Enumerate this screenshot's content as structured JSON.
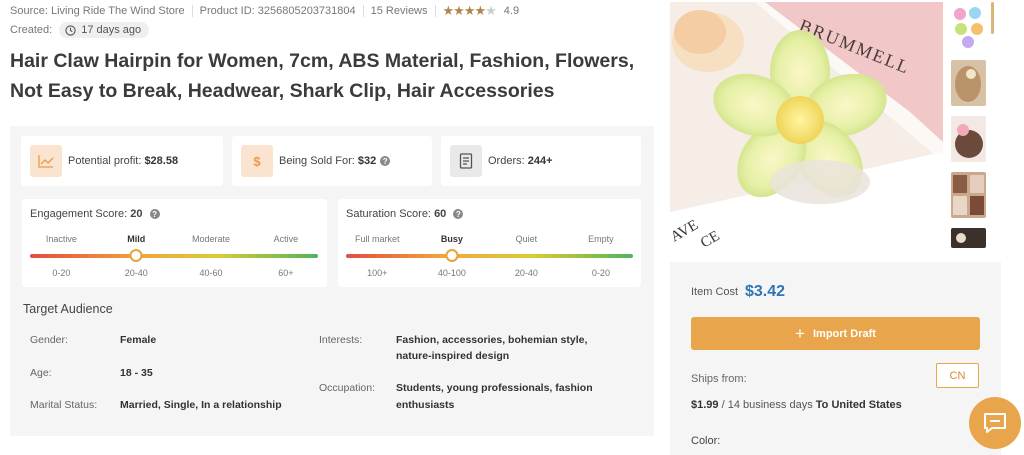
{
  "meta": {
    "source": "Source: Living Ride The Wind Store",
    "product_id": "Product ID: 3256805203731804",
    "reviews": "15 Reviews",
    "rating": "4.9",
    "rating_stars": 4.5,
    "created_label": "Created:",
    "created_value": "17 days ago"
  },
  "title": "Hair Claw Hairpin for Women, 7cm, ABS Material, Fashion, Flowers, Not Easy to Break, Headwear, Shark Clip, Hair Accessories",
  "stats": {
    "profit_label": "Potential profit:",
    "profit_value": "$28.58",
    "sold_label": "Being Sold For:",
    "sold_value": "$32",
    "orders_label": "Orders:",
    "orders_value": "244+"
  },
  "engagement": {
    "label": "Engagement Score:",
    "value": "20",
    "levels": [
      "Inactive",
      "Mild",
      "Moderate",
      "Active"
    ],
    "selected_level": 1,
    "ranges": [
      "0-20",
      "20-40",
      "40-60",
      "60+"
    ]
  },
  "saturation": {
    "label": "Saturation Score:",
    "value": "60",
    "levels": [
      "Full market",
      "Busy",
      "Quiet",
      "Empty"
    ],
    "selected_level": 1,
    "ranges": [
      "100+",
      "40-100",
      "20-40",
      "0-20"
    ]
  },
  "audience": {
    "title": "Target Audience",
    "gender_label": "Gender:",
    "gender": "Female",
    "age_label": "Age:",
    "age": "18 - 35",
    "marital_label": "Marital Status:",
    "marital": "Married, Single, In a relationship",
    "interests_label": "Interests:",
    "interests_1": "Fashion, accessories, bohemian style,",
    "interests_2": "nature-inspired design",
    "occupation_label": "Occupation:",
    "occupation_1": "Students, young professionals, fashion",
    "occupation_2": "enthusiasts"
  },
  "image": {
    "box_text": "BRUMMELL",
    "corner_text_1": "AVE",
    "corner_text_2": "CE"
  },
  "purchase": {
    "cost_label": "Item Cost",
    "cost": "$3.42",
    "import_button": "Import Draft",
    "ships_from_label": "Ships from:",
    "ships_from": "CN",
    "shipping_price": "$1.99",
    "shipping_days": "/ 14 business days",
    "shipping_dest": "To United States",
    "color_label": "Color:"
  },
  "colors": {
    "accent": "#e9a54b",
    "price_blue": "#2f74b5",
    "star": "#b0854a"
  }
}
